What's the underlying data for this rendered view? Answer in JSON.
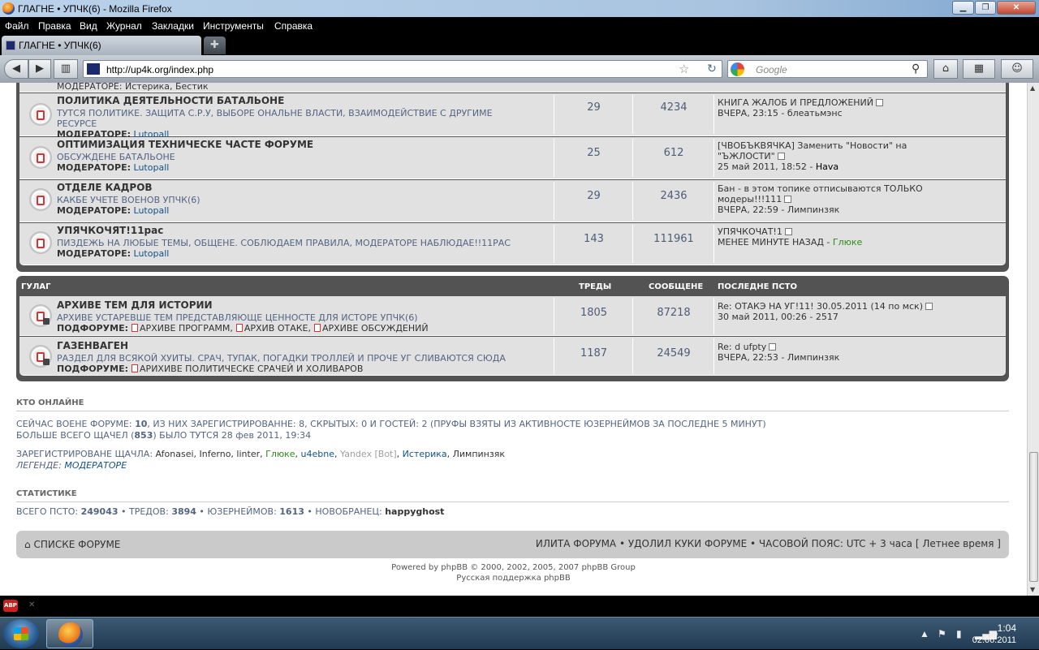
{
  "window": {
    "title": "ГЛАГНЕ • УПЧК(6) - Mozilla Firefox"
  },
  "menu": [
    "Файл",
    "Правка",
    "Вид",
    "Журнал",
    "Закладки",
    "Инструменты",
    "Справка"
  ],
  "tab": {
    "label": "ГЛАГНЕ • УПЧК(6)"
  },
  "nav": {
    "url": "http://up4k.org/index.php",
    "search_placeholder": "Google"
  },
  "clipped_mod": "МОДЕРАТОРЕ: Истерика, Бестик",
  "forums1": [
    {
      "title": "ПОЛИТИКА ДЕЯТЕЛЬНОСТИ БАТАЛЬОНЕ",
      "desc": "ТУТСЯ ПОЛИТИКЕ. ЗАЩИТА С.Р.У, ВЫБОРЕ ОНАЛЬНЕ ВЛАСТИ, ВЗАИМОДЕЙСТВИЕ С ДРУГИМЕ РЕСУРСЕ",
      "mod_label": "МОДЕРАТОРЕ:",
      "mod": "Lutopall",
      "topics": "29",
      "posts": "4234",
      "last1": "КНИГА ЖАЛОБ И ПРЕДЛОЖЕНИЙ",
      "last2": "ВЧЕРА, 23:15 - ",
      "last_user": "блеатьмэнс"
    },
    {
      "title": "ОПТИМИЗАЦИЯ ТЕХНИЧЕСКЕ ЧАСТЕ ФОРУМЕ",
      "desc": "ОБСУЖДЕНЕ БАТАЛЬОНЕ",
      "mod_label": "МОДЕРАТОРЕ:",
      "mod": "Lutopall",
      "topics": "25",
      "posts": "612",
      "last1": "[ЧВОБЪКВЯЧКА] Заменить \"Новости\" на \"ЪЖЛОСТИ\"",
      "last2": "25 май 2011, 18:52 - ",
      "last_user": "Hava"
    },
    {
      "title": "ОТДЕЛЕ КАДРОВ",
      "desc": "КАКБЕ УЧЕТЕ ВОЕНОВ УПЧК(6)",
      "mod_label": "МОДЕРАТОРЕ:",
      "mod": "Lutopall",
      "topics": "29",
      "posts": "2436",
      "last1": "Бан - в этом топике отписываются ТОЛЬКО модеры!!!111",
      "last2": "ВЧЕРА, 22:59 - ",
      "last_user": "Лимпинзяк"
    },
    {
      "title": "УПЯЧКОЧЯТ!11рас",
      "desc": "ПИЗДЕЖЬ НА ЛЮБЫЕ ТЕМЫ, ОБЩЕНЕ. СОБЛЮДАЕМ ПРАВИЛА, МОДЕРАТОРЕ НАБЛЮДАЕ!!11РАС",
      "mod_label": "МОДЕРАТОРЕ:",
      "mod": "Lutopall",
      "topics": "143",
      "posts": "111961",
      "last1": "УПЯЧКОЧАТ!1",
      "last2": "МЕНЕЕ МИНУТЕ НАЗАД - ",
      "last_user": "Глюке"
    }
  ],
  "cat2": {
    "name": "ГУЛАГ",
    "topics_hdr": "ТРЕДЫ",
    "posts_hdr": "СООБЩЕНЕ",
    "last_hdr": "ПОСЛЕДНЕ ПСТО"
  },
  "forums2": [
    {
      "title": "АРХИВЕ ТЕМ ДЛЯ ИСТОРИИ",
      "desc": "АРХИВЕ УСТАРЕВШЕ ТЕМ ПРЕДСТАВЛЯЮЩЕ ЦЕННОСТЕ ДЛЯ ИСТОРЕ УПЧК(6)",
      "sub_label": "ПОДФОРУМЕ:",
      "subs": [
        "АРХИВЕ ПРОГРАММ,",
        "АРХИВ ОТАКЕ,",
        "АРХИВЕ ОБСУЖДЕНИЙ"
      ],
      "topics": "1805",
      "posts": "87218",
      "last1": "Re: ОТАКЭ НА УГ!11! 30.05.2011 (14 по мск)",
      "last2": "30 май 2011, 00:26 - 2517"
    },
    {
      "title": "ГАЗЕНВАГЕН",
      "desc": "РАЗДЕЛ ДЛЯ ВСЯКОЙ ХУИТЫ. СРАЧ, ТУПАК, ПОГАДКИ ТРОЛЛЕЙ И ПРОЧЕ УГ СЛИВАЮТСЯ СЮДА",
      "sub_label": "ПОДФОРУМЕ:",
      "subs": [
        "АРИХИВЕ ПОЛИТИЧЕСКЕ СРАЧЕЙ И ХОЛИВАРОВ"
      ],
      "topics": "1187",
      "posts": "24549",
      "last1": "Re: d ufpty",
      "last2": "ВЧЕРА, 22:53 - Лимпинзяк"
    }
  ],
  "online": {
    "title": "КТО ОНЛАЙНЕ",
    "line1a": "СЕЙЧАС ВОЕНЕ ФОРУМЕ: ",
    "line1n": "10",
    "line1b": ", ИЗ НИХ ЗАРЕГИСТРИРОВАННЕ: 8, СКРЫТЫХ: 0 И ГОСТЕЙ: 2 (ПРУФЫ ВЗЯТЫ ИЗ АКТИВНОСТЕ ЮЗЕРНЕЙМОВ ЗА ПОСЛЕДНЕ 5 МИНУТ)",
    "line2a": "БОЛЬШЕ ВСЕГО ЩАЧЕЛ (",
    "line2n": "853",
    "line2b": ") БЫЛО ТУТСЯ 28 фев 2011, 19:34",
    "reg_label": "ЗАРЕГИСТРИРОВАНЕ ЩАЧЛА: ",
    "users_plain": "Afonasei, Inferno, linter, ",
    "u_g": "Глюке",
    "c1": ", ",
    "u_b": "u4ebne",
    "c2": ", ",
    "u_gr": "Yandex [Bot]",
    "c3": ", ",
    "u_b2": "Истерика",
    "c4": ", Лимпинзяк",
    "legend_label": "ЛЕГЕНДЕ: ",
    "legend": "МОДЕРАТОРЕ"
  },
  "stats": {
    "title": "СТАТИСТИКЕ",
    "a": "ВСЕГО ПСТО: ",
    "a_n": "249043",
    "b": " • ТРЕДОВ: ",
    "b_n": "3894",
    "c": " • ЮЗЕРНЕЙМОВ: ",
    "c_n": "1613",
    "d": " • НОВОБРАНЕЦ: ",
    "d_n": "happyghost"
  },
  "footer": {
    "index": "СПИСКЕ ФОРУМЕ",
    "right": "ИЛИТА ФОРУМА • УДОЛИЛ КУКИ ФОРУМЕ • ЧАСОВОЙ ПОЯС: UTC + 3 часа [ Летнее время ]",
    "powered": "Powered by phpBB © 2000, 2002, 2005, 2007 phpBB Group",
    "support": "Русская поддержка phpBB"
  },
  "addon": {
    "abp": "ABP"
  },
  "clock": {
    "time": "1:04",
    "date": "02.06.2011"
  }
}
